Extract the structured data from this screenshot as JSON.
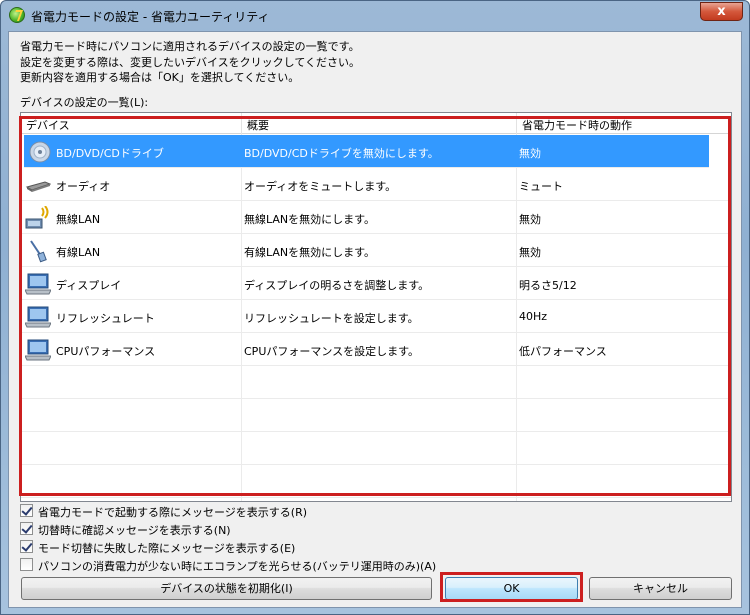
{
  "window": {
    "title": "省電力モードの設定 - 省電力ユーティリティ",
    "close_label": "x"
  },
  "intro": {
    "line1": "省電力モード時にパソコンに適用されるデバイスの設定の一覧です。",
    "line2": "設定を変更する際は、変更したいデバイスをクリックしてください。",
    "line3": "更新内容を適用する場合は「OK」を選択してください。"
  },
  "list": {
    "label": "デバイスの設定の一覧(L):",
    "columns": [
      "デバイス",
      "概要",
      "省電力モード時の動作"
    ],
    "rows": [
      {
        "device": "BD/DVD/CDドライブ",
        "summary": "BD/DVD/CDドライブを無効にします。",
        "action": "無効",
        "icon": "optical-drive-icon"
      },
      {
        "device": "オーディオ",
        "summary": "オーディオをミュートします。",
        "action": "ミュート",
        "icon": "audio-icon"
      },
      {
        "device": "無線LAN",
        "summary": "無線LANを無効にします。",
        "action": "無効",
        "icon": "wireless-lan-icon"
      },
      {
        "device": "有線LAN",
        "summary": "有線LANを無効にします。",
        "action": "無効",
        "icon": "wired-lan-icon"
      },
      {
        "device": "ディスプレイ",
        "summary": "ディスプレイの明るさを調整します。",
        "action": "明るさ5/12",
        "icon": "display-icon"
      },
      {
        "device": "リフレッシュレート",
        "summary": "リフレッシュレートを設定します。",
        "action": "40Hz",
        "icon": "refresh-rate-icon"
      },
      {
        "device": "CPUパフォーマンス",
        "summary": "CPUパフォーマンスを設定します。",
        "action": "低パフォーマンス",
        "icon": "cpu-performance-icon"
      }
    ]
  },
  "options": [
    {
      "label": "省電力モードで起動する際にメッセージを表示する(R)",
      "checked": true
    },
    {
      "label": "切替時に確認メッセージを表示する(N)",
      "checked": true
    },
    {
      "label": "モード切替に失敗した際にメッセージを表示する(E)",
      "checked": true
    },
    {
      "label": "パソコンの消費電力が少ない時にエコランプを光らせる(バッテリ運用時のみ)(A)",
      "checked": false
    }
  ],
  "buttons": {
    "reset": "デバイスの状態を初期化(I)",
    "ok": "OK",
    "cancel": "キャンセル"
  },
  "colors": {
    "selection": "#3399ff",
    "highlight_box": "#cc1f1f"
  }
}
